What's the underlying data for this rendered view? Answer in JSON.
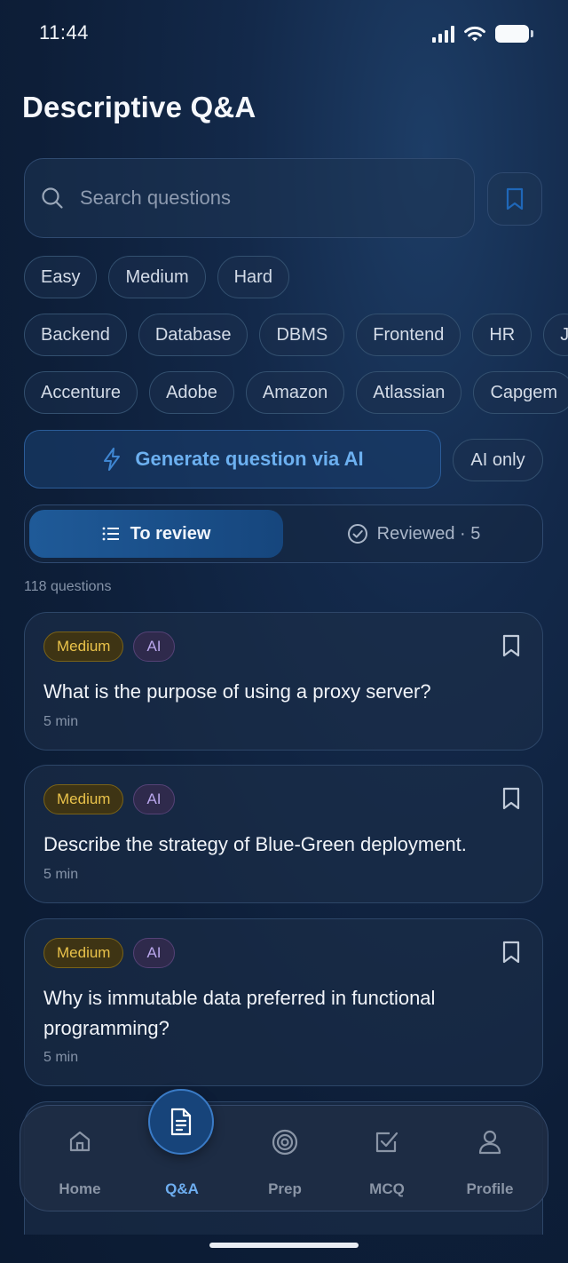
{
  "status_bar": {
    "time": "11:44"
  },
  "page_title": "Descriptive Q&A",
  "search": {
    "placeholder": "Search questions",
    "value": ""
  },
  "difficulty_filters": [
    "Easy",
    "Medium",
    "Hard"
  ],
  "topic_filters": [
    "Backend",
    "Database",
    "DBMS",
    "Frontend",
    "HR",
    "J"
  ],
  "company_filters": [
    "Accenture",
    "Adobe",
    "Amazon",
    "Atlassian",
    "Capgem"
  ],
  "generate_button": {
    "label": "Generate question via AI",
    "icon": "lightning-icon"
  },
  "ai_only_toggle": {
    "label": "AI only"
  },
  "tabs": {
    "to_review": {
      "label": "To review",
      "icon": "list-icon",
      "selected": true
    },
    "reviewed": {
      "label": "Reviewed · 5",
      "icon": "check-circle-icon"
    }
  },
  "question_count": "118 questions",
  "questions": [
    {
      "difficulty": "Medium",
      "tag": "AI",
      "title": "What is the purpose of using a proxy server?",
      "duration": "5 min"
    },
    {
      "difficulty": "Medium",
      "tag": "AI",
      "title": "Describe the strategy of Blue-Green deployment.",
      "duration": "5 min"
    },
    {
      "difficulty": "Medium",
      "tag": "AI",
      "title": "Why is immutable data preferred in functional programming?",
      "duration": "5 min"
    }
  ],
  "bottom_nav": {
    "items": [
      {
        "label": "Home",
        "icon": "home-icon"
      },
      {
        "label": "Q&A",
        "icon": "document-icon",
        "active": true
      },
      {
        "label": "Prep",
        "icon": "target-icon"
      },
      {
        "label": "MCQ",
        "icon": "checkbox-icon"
      },
      {
        "label": "Profile",
        "icon": "user-icon"
      }
    ]
  },
  "colors": {
    "accent": "#6eaef0",
    "medium_badge": "#e9c24a",
    "ai_badge": "#b9a6ec",
    "background": "#0d1e38"
  }
}
